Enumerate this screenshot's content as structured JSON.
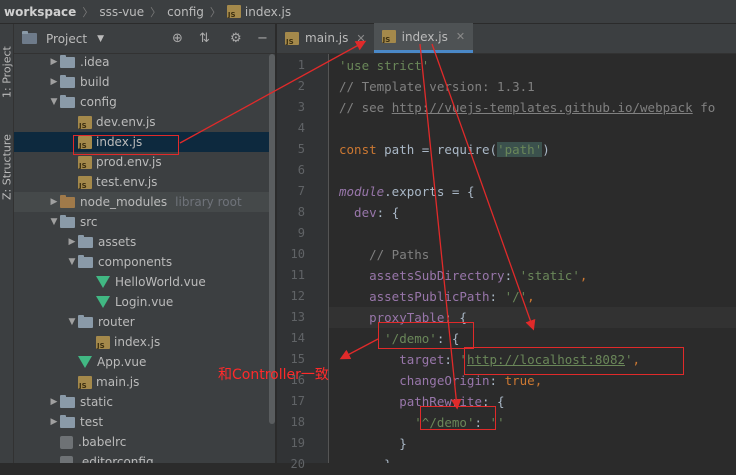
{
  "breadcrumb": {
    "items": [
      {
        "label": "workspace",
        "bold": true,
        "icon": ""
      },
      {
        "label": "sss-vue",
        "bold": false,
        "icon": ""
      },
      {
        "label": "config",
        "bold": false,
        "icon": ""
      },
      {
        "label": "index.js",
        "bold": false,
        "icon": "js-file-icon"
      }
    ]
  },
  "side_strip": {
    "project_tab": "1: Project",
    "structure_tab": "Z: Structure"
  },
  "project_panel": {
    "title": "Project",
    "icons": [
      "target-icon",
      "collapse-icon",
      "gear-icon",
      "hide-icon"
    ]
  },
  "tree": [
    {
      "label": ".idea",
      "type": "folder",
      "depth": 2,
      "expanded": false
    },
    {
      "label": "build",
      "type": "folder",
      "depth": 2,
      "expanded": false
    },
    {
      "label": "config",
      "type": "folder",
      "depth": 2,
      "expanded": true
    },
    {
      "label": "dev.env.js",
      "type": "js",
      "depth": 3
    },
    {
      "label": "index.js",
      "type": "js",
      "depth": 3,
      "selected": true
    },
    {
      "label": "prod.env.js",
      "type": "js",
      "depth": 3
    },
    {
      "label": "test.env.js",
      "type": "js",
      "depth": 3
    },
    {
      "label": "node_modules",
      "type": "folder-excluded",
      "depth": 2,
      "expanded": false,
      "suffix": "library root",
      "highlight": true
    },
    {
      "label": "src",
      "type": "folder",
      "depth": 2,
      "expanded": true
    },
    {
      "label": "assets",
      "type": "folder",
      "depth": 3,
      "expanded": false
    },
    {
      "label": "components",
      "type": "folder",
      "depth": 3,
      "expanded": true
    },
    {
      "label": "HelloWorld.vue",
      "type": "vue",
      "depth": 4
    },
    {
      "label": "Login.vue",
      "type": "vue",
      "depth": 4
    },
    {
      "label": "router",
      "type": "folder",
      "depth": 3,
      "expanded": true
    },
    {
      "label": "index.js",
      "type": "js",
      "depth": 4
    },
    {
      "label": "App.vue",
      "type": "vue",
      "depth": 3
    },
    {
      "label": "main.js",
      "type": "js",
      "depth": 3
    },
    {
      "label": "static",
      "type": "folder",
      "depth": 2,
      "expanded": false
    },
    {
      "label": "test",
      "type": "folder",
      "depth": 2,
      "expanded": false
    },
    {
      "label": ".babelrc",
      "type": "file",
      "depth": 2
    },
    {
      "label": ".editorconfig",
      "type": "file",
      "depth": 2
    }
  ],
  "tabs": [
    {
      "label": "main.js",
      "active": false
    },
    {
      "label": "index.js",
      "active": true
    }
  ],
  "line_numbers": [
    "1",
    "2",
    "3",
    "4",
    "5",
    "6",
    "7",
    "8",
    "9",
    "10",
    "11",
    "12",
    "13",
    "14",
    "15",
    "16",
    "17",
    "18",
    "19",
    "20"
  ],
  "current_line": "13",
  "code_lines": [
    [
      {
        "t": "'use strict'",
        "c": "st"
      }
    ],
    [
      {
        "t": "// Template version: 1.3.1",
        "c": "cm"
      }
    ],
    [
      {
        "t": "// see ",
        "c": "cm"
      },
      {
        "t": "http://vuejs-templates.github.io/webpack",
        "c": "cm ul"
      },
      {
        "t": " fo",
        "c": "cm"
      }
    ],
    [],
    [
      {
        "t": "const ",
        "c": "kw"
      },
      {
        "t": "path = ",
        "c": ""
      },
      {
        "t": "require",
        "c": "fn"
      },
      {
        "t": "(",
        "c": ""
      },
      {
        "t": "'path'",
        "c": "st hlp"
      },
      {
        "t": ")",
        "c": ""
      }
    ],
    [],
    [
      {
        "t": "module",
        "c": "mo"
      },
      {
        "t": ".exports = {",
        "c": ""
      }
    ],
    [
      {
        "t": "  dev",
        "c": "pr"
      },
      {
        "t": ": {",
        "c": ""
      }
    ],
    [],
    [
      {
        "t": "    // Paths",
        "c": "cm"
      }
    ],
    [
      {
        "t": "    assetsSubDirectory",
        "c": "pr"
      },
      {
        "t": ": ",
        "c": ""
      },
      {
        "t": "'static'",
        "c": "st"
      },
      {
        "t": ",",
        "c": "kw"
      }
    ],
    [
      {
        "t": "    assetsPublicPath",
        "c": "pr"
      },
      {
        "t": ": ",
        "c": ""
      },
      {
        "t": "'/'",
        "c": "st"
      },
      {
        "t": ",",
        "c": "kw"
      }
    ],
    [
      {
        "t": "    proxyTable",
        "c": "pr"
      },
      {
        "t": ": {",
        "c": ""
      }
    ],
    [
      {
        "t": "      ",
        "c": ""
      },
      {
        "t": "'/demo'",
        "c": "st"
      },
      {
        "t": ": {",
        "c": ""
      }
    ],
    [
      {
        "t": "        target",
        "c": "pr"
      },
      {
        "t": ": ",
        "c": ""
      },
      {
        "t": "'",
        "c": "st"
      },
      {
        "t": "http://localhost:8082",
        "c": "st ul"
      },
      {
        "t": "'",
        "c": "st"
      },
      {
        "t": ",",
        "c": "kw"
      }
    ],
    [
      {
        "t": "        changeOrigin",
        "c": "pr"
      },
      {
        "t": ": ",
        "c": ""
      },
      {
        "t": "true",
        "c": "kw"
      },
      {
        "t": ",",
        "c": "kw"
      }
    ],
    [
      {
        "t": "        pathRewrite",
        "c": "pr"
      },
      {
        "t": ": {",
        "c": ""
      }
    ],
    [
      {
        "t": "          ",
        "c": ""
      },
      {
        "t": "'^/demo'",
        "c": "st"
      },
      {
        "t": ": ",
        "c": ""
      },
      {
        "t": "''",
        "c": "st"
      }
    ],
    [
      {
        "t": "        }",
        "c": ""
      }
    ],
    [
      {
        "t": "      }",
        "c": ""
      }
    ]
  ],
  "annotation": {
    "label": "和Controller一致",
    "color": "#e02a2a"
  }
}
